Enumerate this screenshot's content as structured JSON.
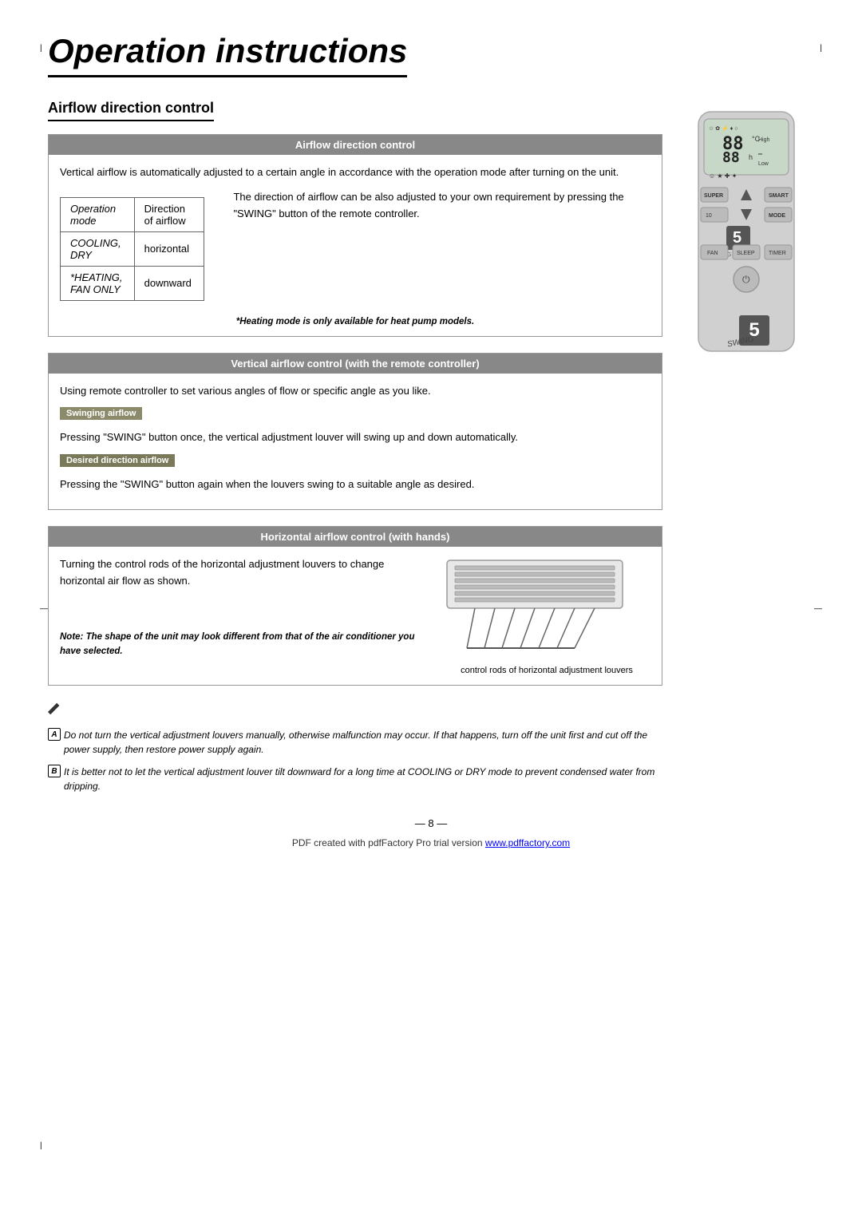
{
  "page": {
    "title": "Operation instructions",
    "page_number": "— 8 —",
    "footer_text": "PDF created with pdfFactory Pro trial version ",
    "footer_link": "www.pdffactory.com"
  },
  "section1": {
    "heading": "Airflow direction control",
    "box_header": "Airflow direction control",
    "intro": "Vertical airflow is automatically adjusted to a certain angle in accordance with the operation mode after turning on the unit.",
    "table": {
      "headers": [
        "Operation mode",
        "Direction of airflow"
      ],
      "rows": [
        [
          "COOLING, DRY",
          "horizontal"
        ],
        [
          "*HEATING,\nFAN ONLY",
          "downward"
        ]
      ]
    },
    "side_text": "The direction of airflow can be also adjusted to your own requirement by pressing the \"SWING\" button of the remote controller.",
    "footnote": "*Heating mode is only available for heat pump models."
  },
  "section2": {
    "header": "Vertical airflow control (with the remote controller)",
    "intro": "Using remote controller to set various angles of flow or specific angle as you like.",
    "swinging_badge": "Swinging airflow",
    "swinging_text": "Pressing \"SWING\" button once, the vertical adjustment louver will swing up and down automatically.",
    "desired_badge": "Desired direction airflow",
    "desired_text": "Pressing the \"SWING\" button again when the louvers swing to a suitable angle as desired."
  },
  "section3": {
    "header": "Horizontal airflow control (with hands)",
    "text": "Turning the control rods of the horizontal adjustment louvers to change horizontal air flow as shown.",
    "note": "Note: The shape of the unit may look different from that of the air conditioner you have selected.",
    "label": "control rods of horizontal adjustment louvers"
  },
  "notes": {
    "icon_label": "pencil",
    "note_A": "Do not turn the vertical adjustment louvers manually, otherwise malfunction may occur. If that happens, turn off the unit first and cut off the power supply,  then restore power supply again.",
    "note_B": "It is better not to let the vertical adjustment louver tilt downward for a long time at COOLING or DRY mode to prevent condensed water from dripping."
  }
}
